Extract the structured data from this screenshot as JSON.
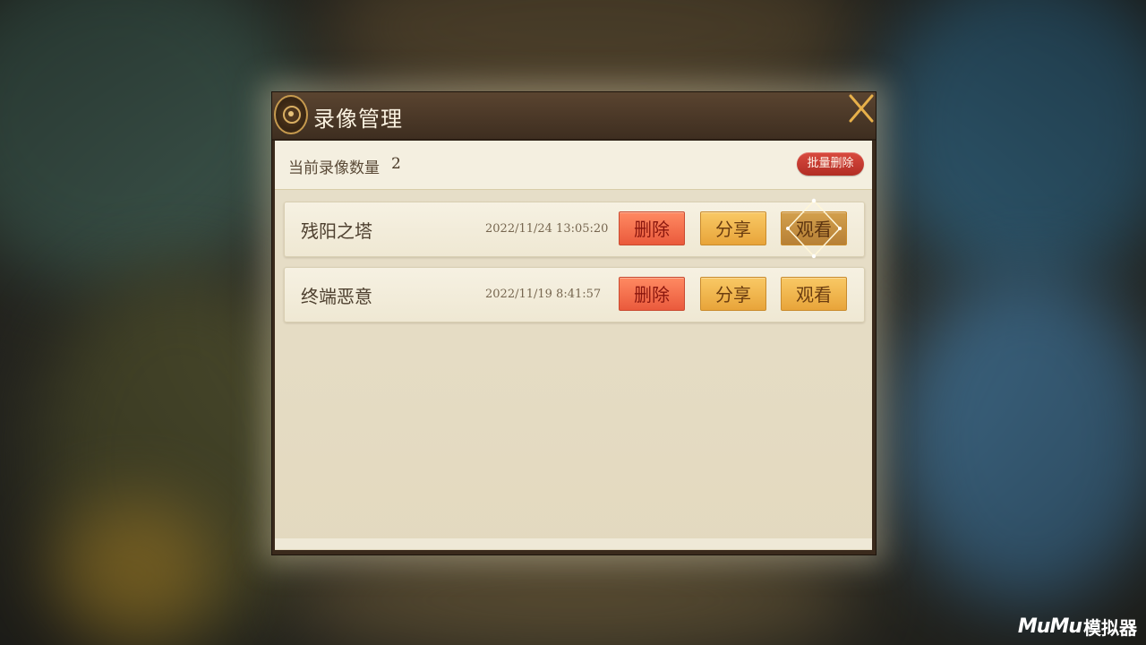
{
  "dialog": {
    "title": "录像管理",
    "count_label": "当前录像数量",
    "count_value": "2",
    "batch_delete_label": "批量删除"
  },
  "records": [
    {
      "name": "残阳之塔",
      "time": "2022/11/24 13:05:20",
      "delete_label": "删除",
      "share_label": "分享",
      "watch_label": "观看"
    },
    {
      "name": "终端恶意",
      "time": "2022/11/19 8:41:57",
      "delete_label": "删除",
      "share_label": "分享",
      "watch_label": "观看"
    }
  ],
  "watermark": {
    "logo": "MuMu",
    "text": "模拟器"
  },
  "colors": {
    "header_dark": "#4a3826",
    "panel_light": "#f4efe0",
    "delete_red": "#ea5a3c",
    "action_gold": "#e8a43a",
    "batch_red": "#c23a30",
    "close_gold": "#e7b04a"
  }
}
